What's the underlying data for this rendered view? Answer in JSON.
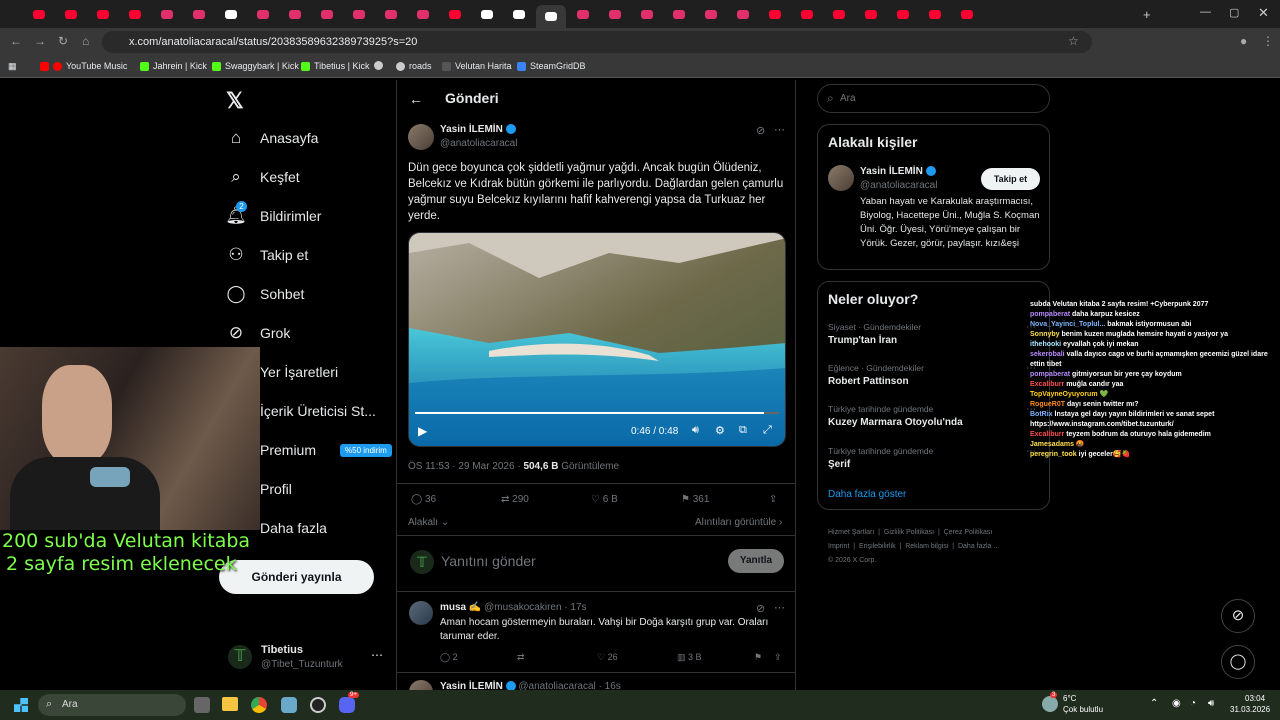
{
  "browser": {
    "url": "x.com/anatoliacaracal/status/2038358963238973925?s=20",
    "bookmarks": [
      "YouTube Music",
      "Jahrein | Kick",
      "Swaggybark | Kick",
      "Tibetius | Kick",
      "roads",
      "Velutan Harita",
      "SteamGridDB"
    ]
  },
  "nav": {
    "items": [
      "Anasayfa",
      "Keşfet",
      "Bildirimler",
      "Takip et",
      "Sohbet",
      "Grok",
      "Yer İşaretleri",
      "İçerik Üreticisi St...",
      "Premium",
      "Profil",
      "Daha fazla"
    ],
    "notification_count": "2",
    "premium_badge": "%50 indirim",
    "post_button": "Gönderi yayınla",
    "account_name": "Tibetius",
    "account_handle": "@Tibet_Tuzunturk"
  },
  "header": {
    "title": "Gönderi"
  },
  "tweet": {
    "author": "Yasin İLEMİN",
    "handle": "@anatoliacaracal",
    "text": "Dün gece boyunca çok şiddetli yağmur yağdı. Ancak bugün Ölüdeniz, Belcekız ve Kıdrak bütün görkemi ile parlıyordu. Dağlardan gelen çamurlu yağmur suyu Belcekız kıyılarını hafif kahverengi yapsa da Turkuaz her yerde.",
    "video_time": "0:46 / 0:48",
    "video_progress": 0.96,
    "meta_time": "ÖS 11:53 · 29 Mar 2026 · ",
    "views": "504,6 B",
    "views_label": "Görüntüleme",
    "replies": "36",
    "reposts": "290",
    "likes": "6 B",
    "bookmarks": "361",
    "related": "Alakalı",
    "quotes_link": "Alıntıları görüntüle"
  },
  "reply_box": {
    "placeholder": "Yanıtını gönder",
    "button": "Yanıtla"
  },
  "reply1": {
    "author": "musa ✍",
    "handle": "@musakocakiren · 17s",
    "text": "Aman hocam göstermeyin buraları. Vahşi bir Doğa karşıtı grup var. Oraları tarumar eder.",
    "replies": "2",
    "likes": "26",
    "views": "3 B"
  },
  "reply2": {
    "author": "Yasin İLEMİN",
    "handle": "@anatoliacaracal · 16s"
  },
  "search": {
    "placeholder": "Ara"
  },
  "relevant": {
    "title": "Alakalı kişiler",
    "name": "Yasin İLEMİN",
    "handle": "@anatoliacaracal",
    "follow": "Takip et",
    "bio": "Yaban hayatı ve Karakulak araştırmacısı, Biyolog, Hacettepe Üni., Muğla S. Koçman Üni. Öğr. Üyesi, Yörü'meye çalışan bir Yörük. Gezer, görür, paylaşır. kızı&eşi"
  },
  "trends": {
    "title": "Neler oluyor?",
    "items": [
      {
        "category": "Siyaset · Gündemdekiler",
        "name": "Trump'tan İran"
      },
      {
        "category": "Eğlence · Gündemdekiler",
        "name": "Robert Pattinson"
      },
      {
        "category": "Türkiye tarihinde gündemde",
        "name": "Kuzey Marmara Otoyolu'nda"
      },
      {
        "category": "Türkiye tarihinde gündemde",
        "name": "Şerif"
      }
    ],
    "more": "Daha fazla göster"
  },
  "footer": {
    "row1": [
      "Hizmet Şartları",
      "Gizlilik Politikası",
      "Çerez Politikası"
    ],
    "row2": [
      "Imprint",
      "Erişilebilirlik",
      "Reklam bilgisi",
      "Daha fazla ..."
    ],
    "copyright": "© 2026 X Corp."
  },
  "stream": {
    "caption_line1": "200 sub'da Velutan kitaba",
    "caption_line2": "2 sayfa resim eklenecek",
    "chat": [
      {
        "user": "",
        "text": "subda Velutan kitaba 2 sayfa resim! +Cyberpunk 2077",
        "color": "#ffffff"
      },
      {
        "user": "pompaberat",
        "text": "daha karpuz kesicez",
        "color": "#b98cff"
      },
      {
        "user": "Nova_Yayinci_Toplul...",
        "text": "bakmak istiyormusun abi",
        "color": "#7fb4ff"
      },
      {
        "user": "Sonnyby",
        "text": "benim kuzen muglada hemsire hayati o yasiyor ya",
        "color": "#ffe14d"
      },
      {
        "user": "ithehooki",
        "text": "eyvallah çok iyi mekan",
        "color": "#a8e6ff"
      },
      {
        "user": "sekerobali",
        "text": "valla dayıco cago ve burhi açmamışken gecemizi güzel idare ettin tibet",
        "color": "#b98cff"
      },
      {
        "user": "pompaberat",
        "text": "gitmiyorsun bir yere çay koydum",
        "color": "#b98cff"
      },
      {
        "user": "Excaliburr",
        "text": "muğla candır yaa",
        "color": "#ff4d4d"
      },
      {
        "user": "TopVayneOyuyorum",
        "text": "💚",
        "color": "#ffd11a"
      },
      {
        "user": "RogueR0T",
        "text": "dayı senin twitter mı?",
        "color": "#ff8c1a"
      },
      {
        "user": "BotRix",
        "text": "İnstaya gel dayı yayın bildirimleri ve sanat sepet https://www.instagram.com/tibet.tuzunturk/",
        "color": "#7fb4ff"
      },
      {
        "user": "Excaliburr",
        "text": "teyzem bodrum da oturuyo hala gidemedim",
        "color": "#ff4d4d"
      },
      {
        "user": "Jamesadams",
        "text": "🤬",
        "color": "#ffe14d"
      },
      {
        "user": "peregrin_took",
        "text": "iyi geceler🥰🍓",
        "color": "#ffe14d"
      }
    ]
  },
  "taskbar": {
    "search": "Ara",
    "weather_temp": "6°C",
    "weather_text": "Çok bulutlu",
    "time": "03:04",
    "date": "31.03.2026",
    "weather_badge": "3",
    "discord_badge": "9+"
  },
  "colors": {
    "accent": "#1d9bf0",
    "caption": "#7dff4a"
  }
}
